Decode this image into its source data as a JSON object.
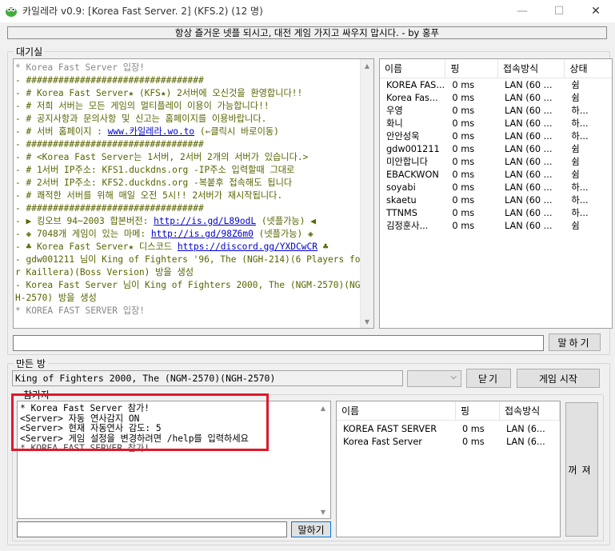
{
  "window": {
    "title": "카일레라 v0.9: [Korea Fast Server. 2] (KFS.2) (12 명)",
    "minimize_glyph": "—",
    "maximize_glyph": "☐",
    "close_glyph": "✕",
    "icon": "kaillera-app-icon"
  },
  "notice": "항상 즐거운 넷플 되시고, 대전 게임 가지고 싸우지 맙시다. - by 홍푸",
  "lobby": {
    "label": "대기실",
    "chat_lines": [
      {
        "text": "* Korea Fast Server 입장!",
        "style": "gray"
      },
      {
        "text": "- #################################"
      },
      {
        "text": "- # Korea Fast Server★ (KFS★) 2서버에 오신것을 환영합니다!!"
      },
      {
        "text": "- # 저희 서버는 모든 게임의 멀티플레이 이용이 가능합니다!!"
      },
      {
        "text": "- # 공지사항과 문의사항 및 신고는 홈페이지를 이용바랍니다."
      },
      {
        "text": "- # 서버 홈페이지 : ",
        "link": "www.카일레라.wo.to",
        "after": " (←클릭시 바로이동)"
      },
      {
        "text": "- #################################"
      },
      {
        "text": "- # <Korea Fast Server는 1서버, 2서버 2개의 서버가 있습니다.>"
      },
      {
        "text": "- # 1서버 IP주소: KFS1.duckdns.org -IP주소 입력할때 그대로"
      },
      {
        "text": "- # 2서버 IP주소: KFS2.duckdns.org -복붙후 접속해도 됩니다"
      },
      {
        "text": "- # 쾌적한 서버를 위해 매일 오전 5시!! 2서버가 재시작됩니다."
      },
      {
        "text": "- #################################"
      },
      {
        "text": "- ▶ 킹오브 94~2003 합본버전: ",
        "link": "http://is.gd/L89odL",
        "after": " (넷플가능) ◀"
      },
      {
        "text": "- ◈ 7048개 게임이 있는 마메: ",
        "link": "http://is.gd/98Z6m0",
        "after": " (넷플가능) ◈"
      },
      {
        "text": "- ♣ Korea Fast Server★ 디스코드 ",
        "link": "https://discord.gg/YXDCwCR",
        "after": " ♣"
      },
      {
        "text": "- gdw001211 님이 King of Fighters '96, The (NGH-214)(6 Players for Kaillera)(Boss Version) 방을 생성"
      },
      {
        "text": "- Korea Fast Server 님이 King of Fighters 2000, The (NGM-2570)(NGH-2570) 방을 생성"
      },
      {
        "text": "* KOREA FAST SERVER 입장!",
        "style": "gray"
      }
    ],
    "user_columns": [
      "이름",
      "핑",
      "접속방식",
      "상태"
    ],
    "users": [
      {
        "name": "KOREA FAS...",
        "ping": "0 ms",
        "conn": "LAN (60 ...",
        "status": "쉼"
      },
      {
        "name": "Korea Fas...",
        "ping": "0 ms",
        "conn": "LAN (60 ...",
        "status": "쉼"
      },
      {
        "name": "우영",
        "ping": "0 ms",
        "conn": "LAN (60 ...",
        "status": "하..."
      },
      {
        "name": "화니",
        "ping": "0 ms",
        "conn": "LAN (60 ...",
        "status": "하..."
      },
      {
        "name": "안안성욱",
        "ping": "0 ms",
        "conn": "LAN (60 ...",
        "status": "하..."
      },
      {
        "name": "gdw001211",
        "ping": "0 ms",
        "conn": "LAN (60 ...",
        "status": "쉼"
      },
      {
        "name": "미안합니다",
        "ping": "0 ms",
        "conn": "LAN (60 ...",
        "status": "쉼"
      },
      {
        "name": "EBACKWON",
        "ping": "0 ms",
        "conn": "LAN (60 ...",
        "status": "쉼"
      },
      {
        "name": "soyabi",
        "ping": "0 ms",
        "conn": "LAN (60 ...",
        "status": "하..."
      },
      {
        "name": "skaetu",
        "ping": "0 ms",
        "conn": "LAN (60 ...",
        "status": "하..."
      },
      {
        "name": "TTNMS",
        "ping": "0 ms",
        "conn": "LAN (60 ...",
        "status": "하..."
      },
      {
        "name": "김정훈사...",
        "ping": "0 ms",
        "conn": "LAN (60 ...",
        "status": "쉼"
      }
    ],
    "input_value": "",
    "talk_button": "말하기"
  },
  "room": {
    "label": "만든 방",
    "game_name": "King of Fighters 2000, The (NGM-2570)(NGH-2570)",
    "select_value": "",
    "close_button": "닫기",
    "start_button": "게임 시작",
    "participants_label": "참가자",
    "chat_lines": [
      {
        "text": "* Korea Fast Server 참가!"
      },
      {
        "text": "<Server> 자동 연사감지 ON"
      },
      {
        "text": "<Server> 현재 자동연사 감도: 5"
      },
      {
        "text": "<Server> 게임 설정을 변경하려면 /help를 입력하세요"
      },
      {
        "text": "* KOREA FAST SERVER 참가!",
        "style": "ghost"
      }
    ],
    "member_columns": [
      "이름",
      "핑",
      "접속방식"
    ],
    "members": [
      {
        "name": "KOREA FAST SERVER",
        "ping": "0 ms",
        "conn": "LAN (6..."
      },
      {
        "name": "Korea Fast Server",
        "ping": "0 ms",
        "conn": "LAN (6..."
      }
    ],
    "input_value": "",
    "talk_button": "말하기",
    "kick_button": "꺼져"
  },
  "scroll": {
    "up": "▲",
    "down": "▼"
  },
  "colors": {
    "highlight": "#e0182a",
    "lobby_text": "#5a6400",
    "link": "#0000cc"
  }
}
